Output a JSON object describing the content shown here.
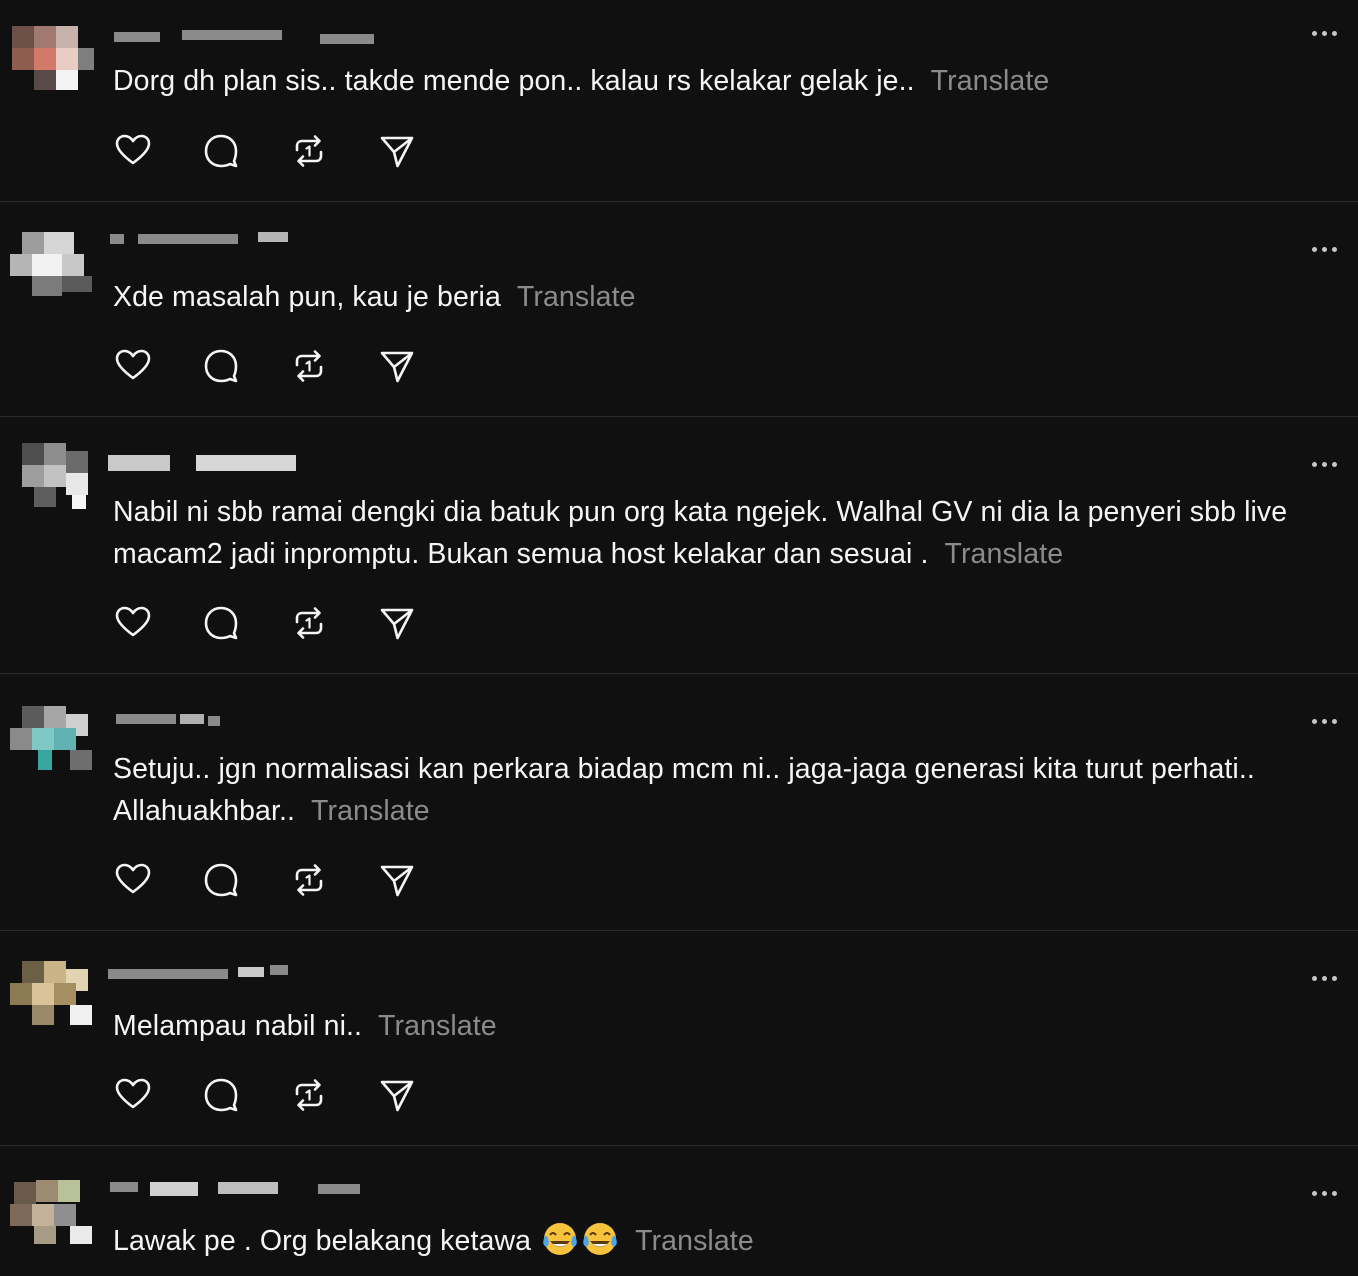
{
  "colors": {
    "background": "#101010",
    "text": "#f3f5f7",
    "muted": "#8b8b8b",
    "divider": "#2b2b2b"
  },
  "icons": {
    "like": "heart-icon",
    "reply": "speech-bubble-icon",
    "repost": "repost-arrows-icon",
    "share": "paper-plane-icon",
    "more": "ellipsis-icon"
  },
  "posts": [
    {
      "text": "Dorg dh plan sis.. takde mende pon.. kalau rs kelakar gelak je..",
      "translate": "Translate"
    },
    {
      "text": "Xde masalah pun, kau je beria",
      "translate": "Translate"
    },
    {
      "text": "Nabil ni sbb ramai dengki dia batuk pun org kata ngejek. Walhal GV ni dia la penyeri sbb live macam2 jadi inpromptu. Bukan semua host kelakar dan sesuai .",
      "translate": "Translate"
    },
    {
      "text": "Setuju.. jgn normalisasi kan perkara biadap mcm ni.. jaga-jaga generasi kita turut perhati.. Allahuakhbar..",
      "translate": "Translate"
    },
    {
      "text": "Melampau nabil ni..",
      "translate": "Translate"
    },
    {
      "text": "Lawak pe . Org belakang ketawa",
      "emoji": "😂😂",
      "translate": "Translate"
    }
  ]
}
